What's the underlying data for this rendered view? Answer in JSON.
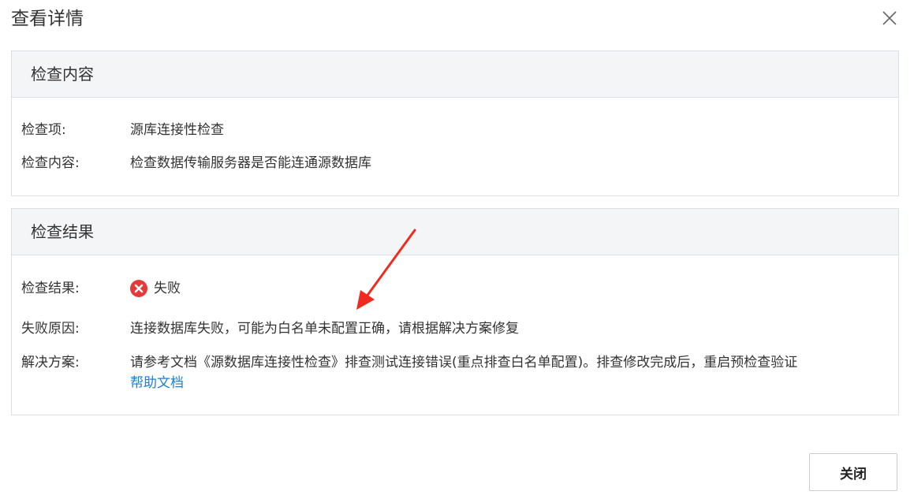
{
  "dialog": {
    "title": "查看详情"
  },
  "content_panel": {
    "header": "检查内容",
    "rows": [
      {
        "label": "检查项:",
        "value": "源库连接性检查"
      },
      {
        "label": "检查内容:",
        "value": "检查数据传输服务器是否能连通源数据库"
      }
    ]
  },
  "result_panel": {
    "header": "检查结果",
    "result_label": "检查结果:",
    "result_value": "失败",
    "reason_label": "失败原因:",
    "reason_value": "连接数据库失败，可能为白名单未配置正确，请根据解决方案修复",
    "solution_label": "解决方案:",
    "solution_value": "请参考文档《源数据库连接性检查》排查测试连接错误(重点排查白名单配置)。排查修改完成后，重启预检查验证",
    "help_link": "帮助文档"
  },
  "footer": {
    "close_label": "关闭"
  },
  "colors": {
    "fail_red": "#e5393a",
    "link_blue": "#1e7fd1",
    "annotation_red": "#f02a1f"
  },
  "icons": {
    "close": "close-x-icon",
    "fail": "fail-circle-x-icon"
  }
}
